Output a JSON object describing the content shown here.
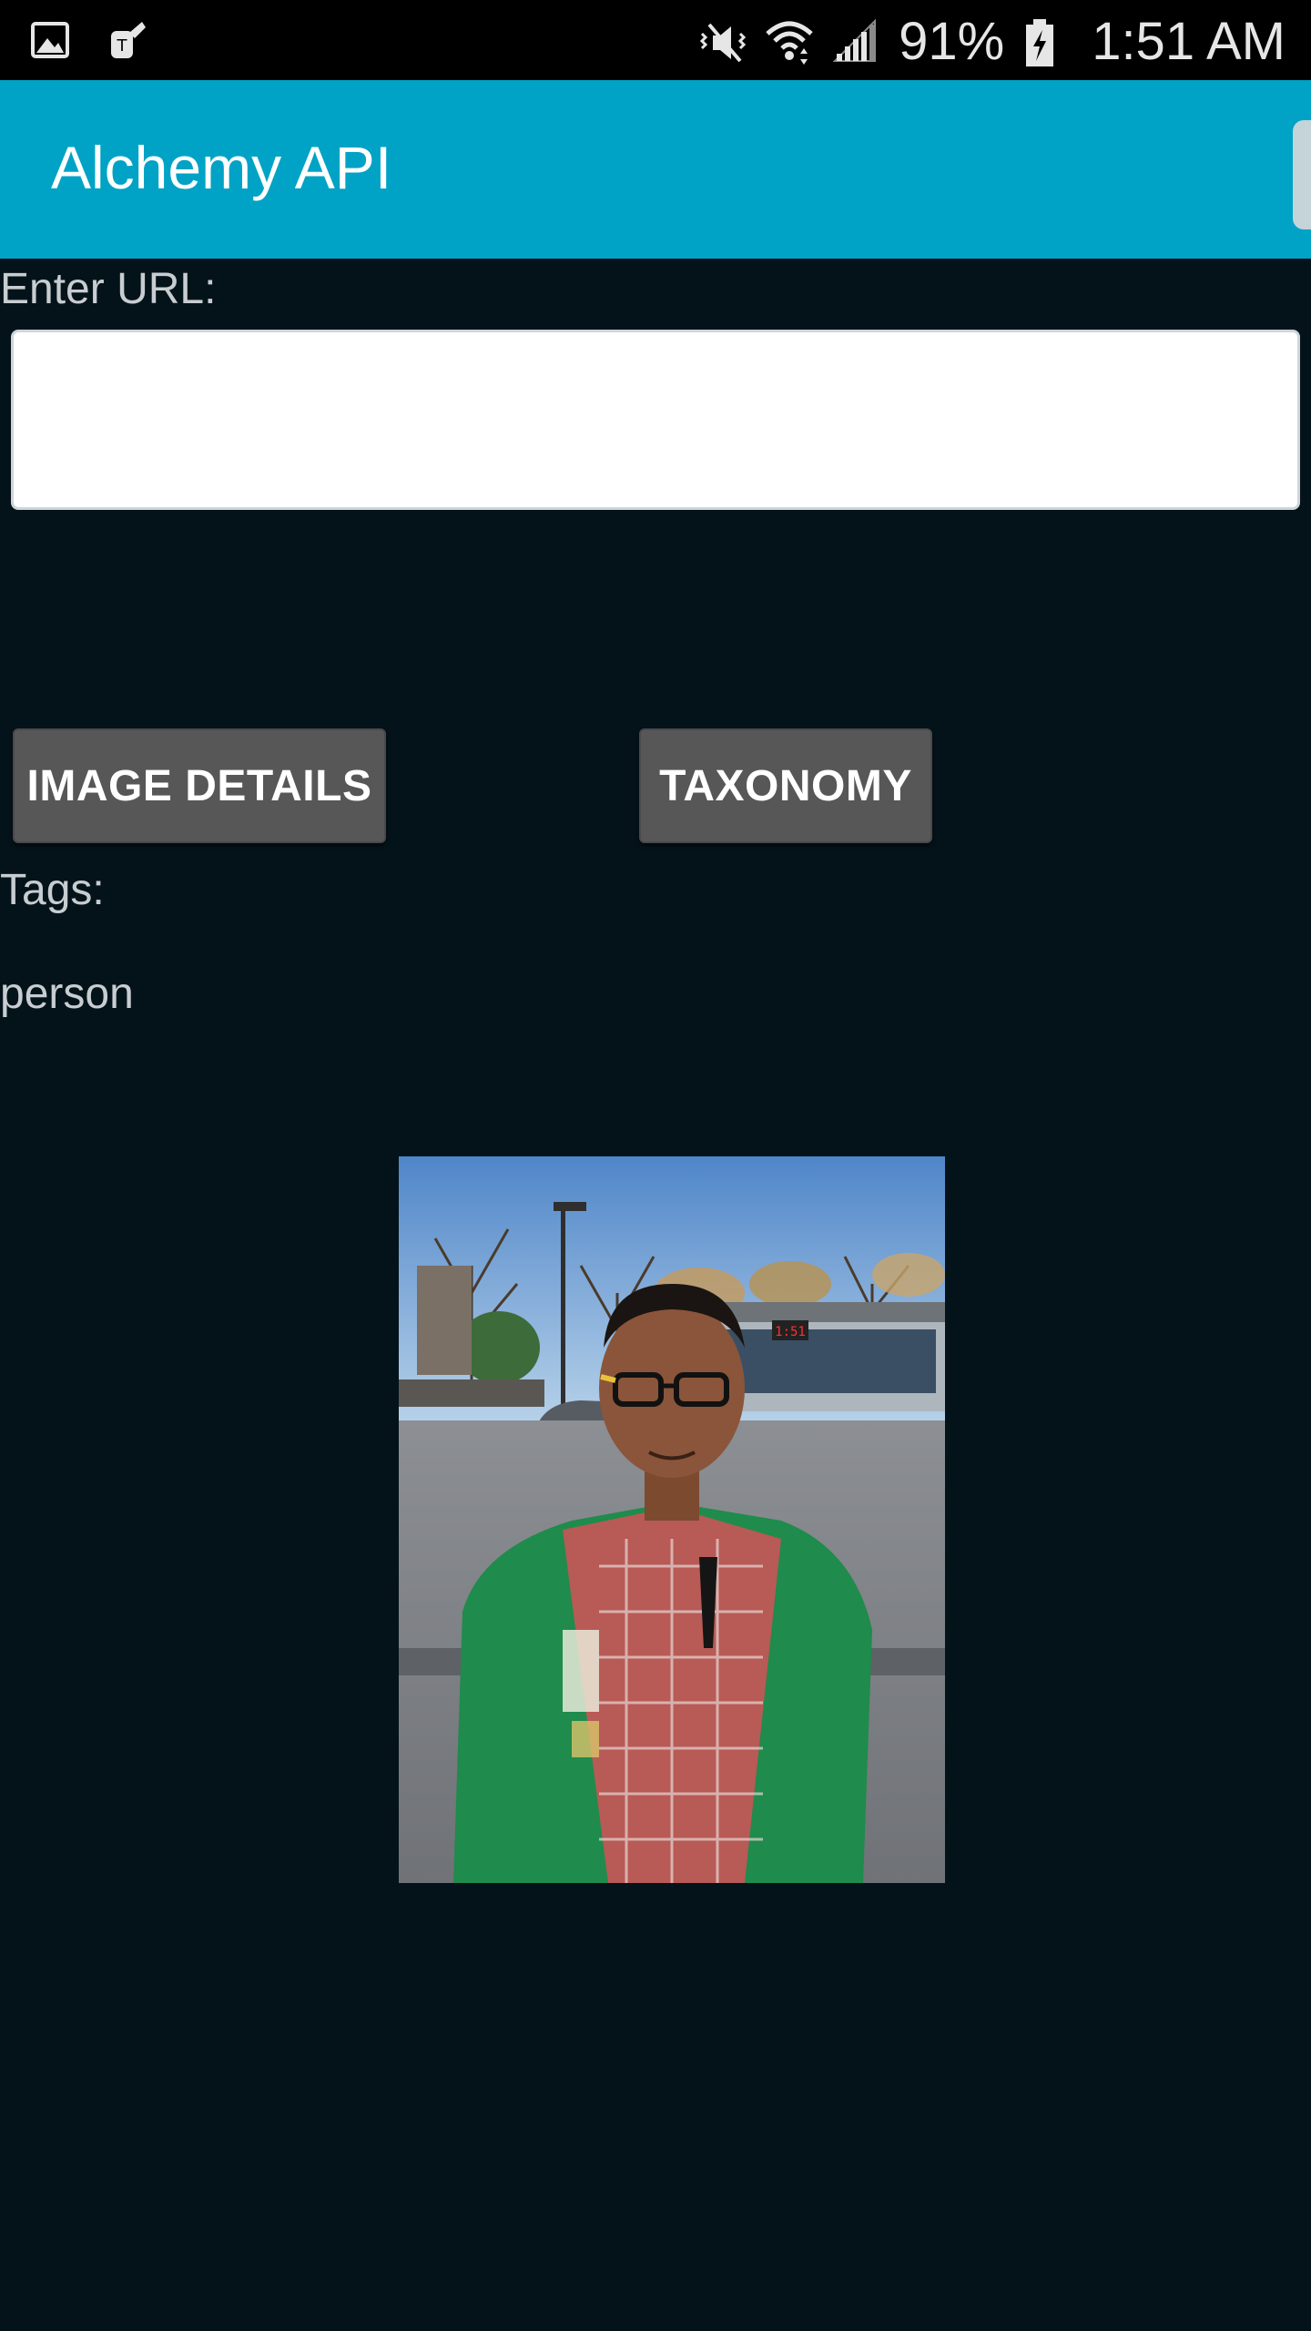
{
  "status_bar": {
    "battery_percent": "91%",
    "time": "1:51 AM",
    "icons": [
      "gallery-icon",
      "tmobile-icon",
      "vibrate-mute-icon",
      "wifi-icon",
      "cell-signal-icon",
      "battery-charging-icon"
    ]
  },
  "app_bar": {
    "title": "Alchemy API",
    "color": "#00a3c5"
  },
  "form": {
    "url_label": "Enter URL:",
    "url_value": ""
  },
  "buttons": {
    "image_details": "IMAGE DETAILS",
    "taxonomy": "TAXONOMY"
  },
  "results": {
    "tags_label": "Tags:",
    "tags": [
      "person"
    ]
  },
  "image": {
    "description": "photo-of-person"
  }
}
